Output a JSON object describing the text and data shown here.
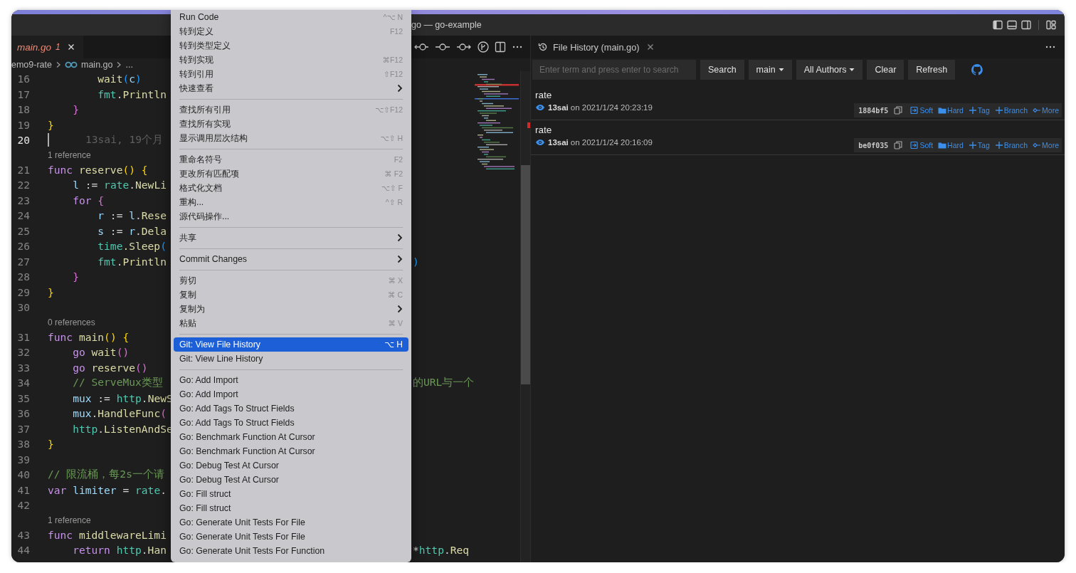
{
  "window": {
    "title": "go — go-example"
  },
  "editor": {
    "tabs": [
      {
        "label": "main.go",
        "badge": "1",
        "selected": true
      }
    ],
    "breadcrumb": [
      "emo9-rate",
      "main.go",
      "..."
    ],
    "lines": [
      {
        "kind": "code",
        "number": "16",
        "current": false,
        "tokens": [
          {
            "text": "        wait",
            "kind": "function"
          },
          {
            "text": "(",
            "kind": "bracket3"
          },
          {
            "text": "c",
            "kind": "variable"
          },
          {
            "text": ")",
            "kind": "bracket3"
          }
        ]
      },
      {
        "kind": "code",
        "number": "17",
        "current": false,
        "tokens": [
          {
            "text": "        fmt",
            "kind": "package"
          },
          {
            "text": ".",
            "kind": "plain"
          },
          {
            "text": "Println",
            "kind": "function"
          }
        ]
      },
      {
        "kind": "code",
        "number": "18",
        "current": false,
        "tokens": [
          {
            "text": "    }",
            "kind": "bracket2"
          }
        ]
      },
      {
        "kind": "code",
        "number": "19",
        "current": false,
        "tokens": [
          {
            "text": "}",
            "kind": "bracket1"
          }
        ]
      },
      {
        "kind": "code",
        "number": "20",
        "current": true,
        "blame": "13sai, 19个月"
      },
      {
        "kind": "codelens",
        "text": "1 reference"
      },
      {
        "kind": "code",
        "number": "21",
        "current": false,
        "tokens": [
          {
            "text": "func ",
            "kind": "keyword"
          },
          {
            "text": "reserve",
            "kind": "function"
          },
          {
            "text": "() {",
            "kind": "bracket1"
          }
        ]
      },
      {
        "kind": "code",
        "number": "22",
        "current": false,
        "tokens": [
          {
            "text": "    l",
            "kind": "variable"
          },
          {
            "text": " := ",
            "kind": "plain"
          },
          {
            "text": "rate",
            "kind": "package"
          },
          {
            "text": ".",
            "kind": "plain"
          },
          {
            "text": "NewLi",
            "kind": "function"
          }
        ]
      },
      {
        "kind": "code",
        "number": "23",
        "current": false,
        "tokens": [
          {
            "text": "    for ",
            "kind": "keyword"
          },
          {
            "text": "{",
            "kind": "bracket2"
          }
        ]
      },
      {
        "kind": "code",
        "number": "24",
        "current": false,
        "tokens": [
          {
            "text": "        r",
            "kind": "variable"
          },
          {
            "text": " := ",
            "kind": "plain"
          },
          {
            "text": "l",
            "kind": "variable"
          },
          {
            "text": ".",
            "kind": "plain"
          },
          {
            "text": "Rese",
            "kind": "function"
          }
        ]
      },
      {
        "kind": "code",
        "number": "25",
        "current": false,
        "tokens": [
          {
            "text": "        s",
            "kind": "variable"
          },
          {
            "text": " := ",
            "kind": "plain"
          },
          {
            "text": "r",
            "kind": "variable"
          },
          {
            "text": ".",
            "kind": "plain"
          },
          {
            "text": "Dela",
            "kind": "function"
          }
        ]
      },
      {
        "kind": "code",
        "number": "26",
        "current": false,
        "tokens": [
          {
            "text": "        time",
            "kind": "package"
          },
          {
            "text": ".Sleep",
            "kind": "function"
          },
          {
            "text": "(",
            "kind": "bracket3"
          }
        ]
      },
      {
        "kind": "code",
        "number": "27",
        "current": false,
        "tokens": [
          {
            "text": "        fmt",
            "kind": "package"
          },
          {
            "text": ".",
            "kind": "plain"
          },
          {
            "text": "Println",
            "kind": "function"
          }
        ],
        "right": [
          {
            "text": ")",
            "kind": "bracket3"
          }
        ]
      },
      {
        "kind": "code",
        "number": "28",
        "current": false,
        "tokens": [
          {
            "text": "    }",
            "kind": "bracket2"
          }
        ]
      },
      {
        "kind": "code",
        "number": "29",
        "current": false,
        "tokens": [
          {
            "text": "}",
            "kind": "bracket1"
          }
        ]
      },
      {
        "kind": "code",
        "number": "30",
        "current": false
      },
      {
        "kind": "codelens",
        "text": "0 references"
      },
      {
        "kind": "code",
        "number": "31",
        "current": false,
        "tokens": [
          {
            "text": "func ",
            "kind": "keyword"
          },
          {
            "text": "main",
            "kind": "function"
          },
          {
            "text": "() {",
            "kind": "bracket1"
          }
        ]
      },
      {
        "kind": "code",
        "number": "32",
        "current": false,
        "tokens": [
          {
            "text": "    go ",
            "kind": "keyword"
          },
          {
            "text": "wait",
            "kind": "function"
          },
          {
            "text": "()",
            "kind": "bracket2"
          }
        ]
      },
      {
        "kind": "code",
        "number": "33",
        "current": false,
        "tokens": [
          {
            "text": "    go ",
            "kind": "keyword"
          },
          {
            "text": "reserve",
            "kind": "function"
          },
          {
            "text": "()",
            "kind": "bracket2"
          }
        ]
      },
      {
        "kind": "code",
        "number": "34",
        "current": false,
        "tokens": [
          {
            "text": "    // ServeMux类型",
            "kind": "comment"
          }
        ],
        "right": [
          {
            "text": "的URL与一个",
            "kind": "comment"
          }
        ]
      },
      {
        "kind": "code",
        "number": "35",
        "current": false,
        "tokens": [
          {
            "text": "    mux",
            "kind": "variable"
          },
          {
            "text": " := ",
            "kind": "plain"
          },
          {
            "text": "http",
            "kind": "package"
          },
          {
            "text": ".",
            "kind": "plain"
          },
          {
            "text": "NewS",
            "kind": "function"
          }
        ]
      },
      {
        "kind": "code",
        "number": "36",
        "current": false,
        "tokens": [
          {
            "text": "    mux",
            "kind": "variable"
          },
          {
            "text": ".",
            "kind": "plain"
          },
          {
            "text": "HandleFunc",
            "kind": "function"
          },
          {
            "text": "(",
            "kind": "bracket2"
          }
        ]
      },
      {
        "kind": "code",
        "number": "37",
        "current": false,
        "tokens": [
          {
            "text": "    http",
            "kind": "package"
          },
          {
            "text": ".",
            "kind": "plain"
          },
          {
            "text": "ListenAndSe",
            "kind": "function"
          }
        ]
      },
      {
        "kind": "code",
        "number": "38",
        "current": false,
        "tokens": [
          {
            "text": "}",
            "kind": "bracket1"
          }
        ]
      },
      {
        "kind": "code",
        "number": "39",
        "current": false
      },
      {
        "kind": "code",
        "number": "40",
        "current": false,
        "tokens": [
          {
            "text": "// 限流桶，每2s一个请",
            "kind": "comment"
          }
        ]
      },
      {
        "kind": "code",
        "number": "41",
        "current": false,
        "tokens": [
          {
            "text": "var ",
            "kind": "keyword"
          },
          {
            "text": "limiter",
            "kind": "variable"
          },
          {
            "text": " = ",
            "kind": "plain"
          },
          {
            "text": "rate",
            "kind": "package"
          },
          {
            "text": ".",
            "kind": "plain"
          }
        ]
      },
      {
        "kind": "code",
        "number": "42",
        "current": false
      },
      {
        "kind": "codelens",
        "text": "1 reference"
      },
      {
        "kind": "code",
        "number": "43",
        "current": false,
        "tokens": [
          {
            "text": "func ",
            "kind": "keyword"
          },
          {
            "text": "middlewareLimi",
            "kind": "function"
          }
        ]
      },
      {
        "kind": "code",
        "number": "44",
        "current": false,
        "tokens": [
          {
            "text": "    return ",
            "kind": "keyword"
          },
          {
            "text": "http",
            "kind": "package"
          },
          {
            "text": ".",
            "kind": "plain"
          },
          {
            "text": "Han",
            "kind": "function"
          }
        ],
        "right": [
          {
            "text": "*",
            "kind": "plain"
          },
          {
            "text": "http",
            "kind": "package"
          },
          {
            "text": ".",
            "kind": "plain"
          },
          {
            "text": "Req",
            "kind": "function"
          }
        ]
      }
    ]
  },
  "context_menu": {
    "items": [
      {
        "kind": "item",
        "label": "Run Code",
        "shortcut": "^⌥ N",
        "submenu": false,
        "selected": false
      },
      {
        "kind": "item",
        "label": "转到定义",
        "shortcut": "F12",
        "submenu": false,
        "selected": false
      },
      {
        "kind": "item",
        "label": "转到类型定义",
        "submenu": false,
        "selected": false
      },
      {
        "kind": "item",
        "label": "转到实现",
        "shortcut": "⌘F12",
        "submenu": false,
        "selected": false
      },
      {
        "kind": "item",
        "label": "转到引用",
        "shortcut": "⇧F12",
        "submenu": false,
        "selected": false
      },
      {
        "kind": "item",
        "label": "快速查看",
        "submenu": true,
        "selected": false
      },
      {
        "kind": "separator"
      },
      {
        "kind": "item",
        "label": "查找所有引用",
        "shortcut": "⌥⇧F12",
        "submenu": false,
        "selected": false
      },
      {
        "kind": "item",
        "label": "查找所有实现",
        "submenu": false,
        "selected": false
      },
      {
        "kind": "item",
        "label": "显示调用层次结构",
        "shortcut": "⌥⇧ H",
        "submenu": false,
        "selected": false
      },
      {
        "kind": "separator"
      },
      {
        "kind": "item",
        "label": "重命名符号",
        "shortcut": "F2",
        "submenu": false,
        "selected": false
      },
      {
        "kind": "item",
        "label": "更改所有匹配项",
        "shortcut": "⌘ F2",
        "submenu": false,
        "selected": false
      },
      {
        "kind": "item",
        "label": "格式化文档",
        "shortcut": "⌥⇧ F",
        "submenu": false,
        "selected": false
      },
      {
        "kind": "item",
        "label": "重构...",
        "shortcut": "^⇧ R",
        "submenu": false,
        "selected": false
      },
      {
        "kind": "item",
        "label": "源代码操作...",
        "submenu": false,
        "selected": false
      },
      {
        "kind": "separator"
      },
      {
        "kind": "item",
        "label": "共享",
        "submenu": true,
        "selected": false
      },
      {
        "kind": "separator"
      },
      {
        "kind": "item",
        "label": "Commit Changes",
        "submenu": true,
        "selected": false
      },
      {
        "kind": "separator"
      },
      {
        "kind": "item",
        "label": "剪切",
        "shortcut": "⌘ X",
        "submenu": false,
        "selected": false
      },
      {
        "kind": "item",
        "label": "复制",
        "shortcut": "⌘ C",
        "submenu": false,
        "selected": false
      },
      {
        "kind": "item",
        "label": "复制为",
        "submenu": true,
        "selected": false
      },
      {
        "kind": "item",
        "label": "粘贴",
        "shortcut": "⌘ V",
        "submenu": false,
        "selected": false
      },
      {
        "kind": "separator"
      },
      {
        "kind": "item",
        "label": "Git: View File History",
        "shortcut": "⌥ H",
        "submenu": false,
        "selected": true
      },
      {
        "kind": "item",
        "label": "Git: View Line History",
        "submenu": false,
        "selected": false
      },
      {
        "kind": "separator"
      },
      {
        "kind": "item",
        "label": "Go: Add Import",
        "submenu": false,
        "selected": false
      },
      {
        "kind": "item",
        "label": "Go: Add Import",
        "submenu": false,
        "selected": false
      },
      {
        "kind": "item",
        "label": "Go: Add Tags To Struct Fields",
        "submenu": false,
        "selected": false
      },
      {
        "kind": "item",
        "label": "Go: Add Tags To Struct Fields",
        "submenu": false,
        "selected": false
      },
      {
        "kind": "item",
        "label": "Go: Benchmark Function At Cursor",
        "submenu": false,
        "selected": false
      },
      {
        "kind": "item",
        "label": "Go: Benchmark Function At Cursor",
        "submenu": false,
        "selected": false
      },
      {
        "kind": "item",
        "label": "Go: Debug Test At Cursor",
        "submenu": false,
        "selected": false
      },
      {
        "kind": "item",
        "label": "Go: Debug Test At Cursor",
        "submenu": false,
        "selected": false
      },
      {
        "kind": "item",
        "label": "Go: Fill struct",
        "submenu": false,
        "selected": false
      },
      {
        "kind": "item",
        "label": "Go: Fill struct",
        "submenu": false,
        "selected": false
      },
      {
        "kind": "item",
        "label": "Go: Generate Unit Tests For File",
        "submenu": false,
        "selected": false
      },
      {
        "kind": "item",
        "label": "Go: Generate Unit Tests For File",
        "submenu": false,
        "selected": false
      },
      {
        "kind": "item",
        "label": "Go: Generate Unit Tests For Function",
        "submenu": false,
        "selected": false
      }
    ]
  },
  "file_history": {
    "tab": {
      "label": "File History (main.go)",
      "selected": true
    },
    "search": {
      "placeholder": "Enter term and press enter to search"
    },
    "buttons": [
      {
        "label": "Search",
        "kind": "button"
      },
      {
        "label": "main",
        "kind": "dropdown"
      },
      {
        "label": "All Authors",
        "kind": "dropdown"
      },
      {
        "label": "Clear",
        "kind": "button"
      },
      {
        "label": "Refresh",
        "kind": "button"
      }
    ],
    "commits": [
      {
        "message": "rate",
        "author": "13sai",
        "date": "on 2021/1/24 20:23:19",
        "hash": "1884bf5",
        "actions": [
          {
            "label": "Soft",
            "kind": "soft"
          },
          {
            "label": "Hard",
            "kind": "hard"
          },
          {
            "label": "Tag",
            "kind": "tag"
          },
          {
            "label": "Branch",
            "kind": "branch"
          },
          {
            "label": "More",
            "kind": "more"
          }
        ]
      },
      {
        "message": "rate",
        "author": "13sai",
        "date": "on 2021/1/24 20:16:09",
        "hash": "be0f035",
        "actions": [
          {
            "label": "Soft",
            "kind": "soft"
          },
          {
            "label": "Hard",
            "kind": "hard"
          },
          {
            "label": "Tag",
            "kind": "tag"
          },
          {
            "label": "Branch",
            "kind": "branch"
          },
          {
            "label": "More",
            "kind": "more"
          }
        ]
      }
    ]
  }
}
